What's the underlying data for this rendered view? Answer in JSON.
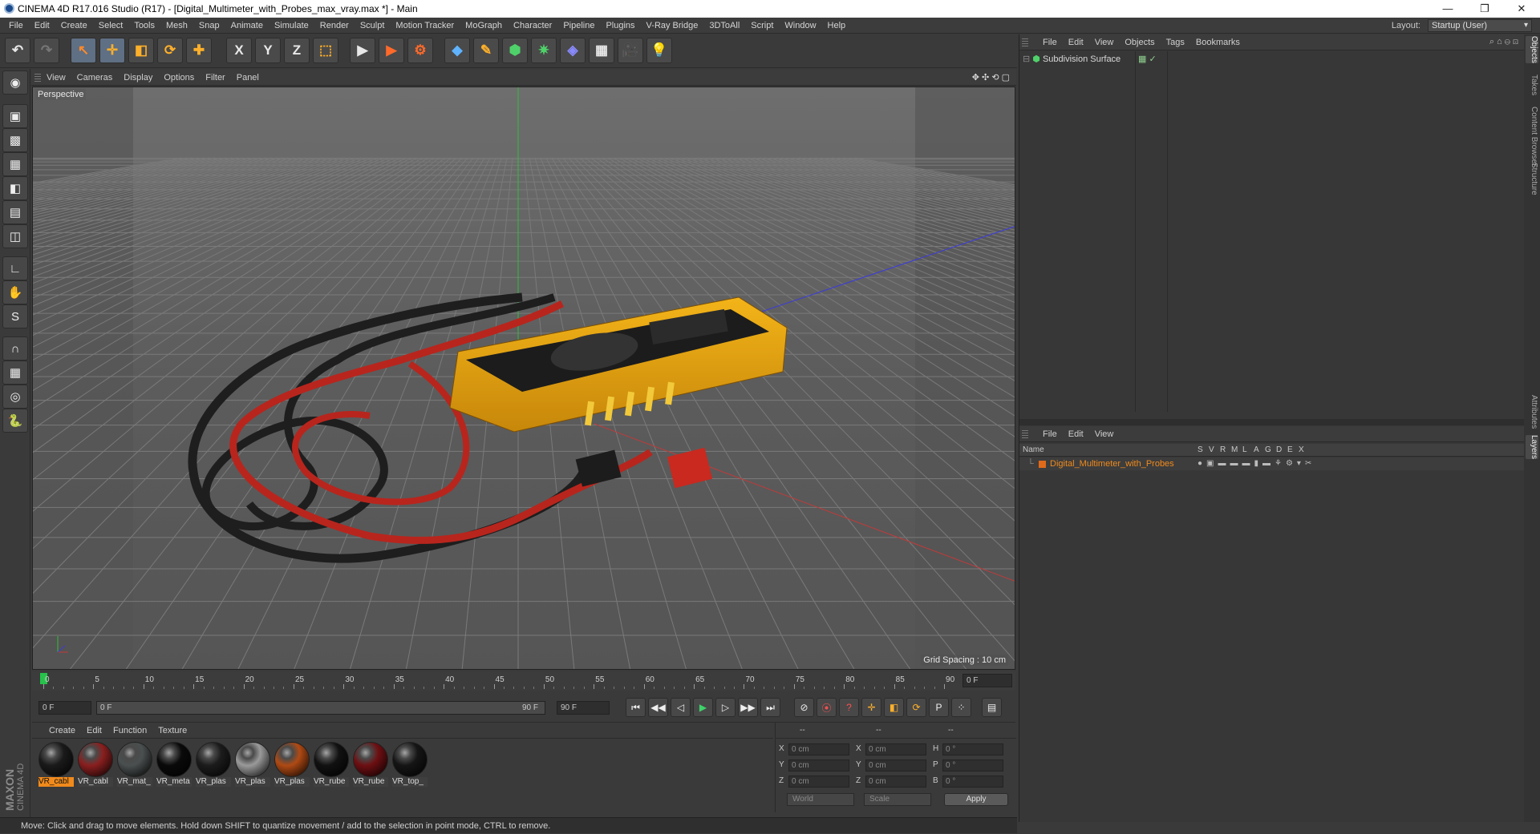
{
  "window": {
    "title": "CINEMA 4D R17.016 Studio (R17) - [Digital_Multimeter_with_Probes_max_vray.max *] - Main",
    "minimize": "—",
    "restore": "❐",
    "close": "✕"
  },
  "menubar": {
    "items": [
      "File",
      "Edit",
      "Create",
      "Select",
      "Tools",
      "Mesh",
      "Snap",
      "Animate",
      "Simulate",
      "Render",
      "Sculpt",
      "Motion Tracker",
      "MoGraph",
      "Character",
      "Pipeline",
      "Plugins",
      "V-Ray Bridge",
      "3DToAll",
      "Script",
      "Window",
      "Help"
    ],
    "layout_label": "Layout:",
    "layout_value": "Startup (User)"
  },
  "toolbar": {
    "undo": "↶",
    "redo": "↷",
    "select": "↖",
    "move": "✛",
    "scale": "◧",
    "rotate": "⟳",
    "create": "✚",
    "x_axis": "X",
    "y_axis": "Y",
    "z_axis": "Z",
    "coord_system": "⬚",
    "render_view": "▶",
    "render_picture": "▶",
    "render_settings": "⚙",
    "cube": "◆",
    "pen": "✎",
    "subdivision": "⬢",
    "array": "✷",
    "deformer": "◈",
    "floor": "▦",
    "camera": "🎥",
    "light": "💡"
  },
  "left_toolbar": [
    "◉",
    "▣",
    "▩",
    "▦",
    "◧",
    "▤",
    "◫",
    "∟",
    "✋",
    "S",
    "∩",
    "▦",
    "◎",
    "🐍"
  ],
  "viewport": {
    "menu": [
      "View",
      "Cameras",
      "Display",
      "Options",
      "Filter",
      "Panel"
    ],
    "label": "Perspective",
    "grid_spacing": "Grid Spacing : 10 cm",
    "nav_icons": "✥ ✣ ⟲ ▢"
  },
  "timeline": {
    "ticks": [
      "0",
      "5",
      "10",
      "15",
      "20",
      "25",
      "30",
      "35",
      "40",
      "45",
      "50",
      "55",
      "60",
      "65",
      "70",
      "75",
      "80",
      "85",
      "90"
    ],
    "current_frame_end": "0 F"
  },
  "playback": {
    "start_field": "0 F",
    "range_start": "0 F",
    "range_end": "90 F",
    "end_field": "90 F",
    "buttons": [
      "⏮",
      "◀◀",
      "◁",
      "▶",
      "▷",
      "▶▶",
      "⏭"
    ],
    "key_buttons": [
      "⊘",
      "⦿",
      "?",
      "✛",
      "◧",
      "⟳",
      "P",
      "⁘",
      "▤"
    ]
  },
  "materials": {
    "menu": [
      "Create",
      "Edit",
      "Function",
      "Texture"
    ],
    "items": [
      {
        "label": "VR_cabl",
        "color": "#1a1a1a",
        "selected": true
      },
      {
        "label": "VR_cabl",
        "color": "#8a1f1f",
        "selected": false
      },
      {
        "label": "VR_mat_",
        "color": "#4a4f4f",
        "selected": false
      },
      {
        "label": "VR_meta",
        "color": "#0a0a0a",
        "selected": false
      },
      {
        "label": "VR_plas",
        "color": "#1c1c1c",
        "selected": false
      },
      {
        "label": "VR_plas",
        "color": "#9a9a9a",
        "selected": false
      },
      {
        "label": "VR_plas",
        "color": "#b04a14",
        "selected": false
      },
      {
        "label": "VR_rube",
        "color": "#111111",
        "selected": false
      },
      {
        "label": "VR_rube",
        "color": "#6e0f12",
        "selected": false
      },
      {
        "label": "VR_top_",
        "color": "#151515",
        "selected": false
      }
    ]
  },
  "coordinates": {
    "headers": [
      "--",
      "--",
      "--"
    ],
    "rows": [
      {
        "a": "X",
        "av": "0 cm",
        "b": "X",
        "bv": "0 cm",
        "c": "H",
        "cv": "0 °"
      },
      {
        "a": "Y",
        "av": "0 cm",
        "b": "Y",
        "bv": "0 cm",
        "c": "P",
        "cv": "0 °"
      },
      {
        "a": "Z",
        "av": "0 cm",
        "b": "Z",
        "bv": "0 cm",
        "c": "B",
        "cv": "0 °"
      }
    ],
    "world": "World",
    "scale": "Scale",
    "apply": "Apply"
  },
  "statusbar": "Move: Click and drag to move elements. Hold down SHIFT to quantize movement / add to the selection in point mode, CTRL to remove.",
  "maxon": {
    "brand": "MAXON",
    "product": "CINEMA 4D"
  },
  "objects_panel": {
    "menu": [
      "File",
      "Edit",
      "View",
      "Objects",
      "Tags",
      "Bookmarks"
    ],
    "items": [
      {
        "name": "Subdivision Surface"
      }
    ]
  },
  "layers_panel": {
    "menu": [
      "File",
      "Edit",
      "View"
    ],
    "columns": [
      "Name",
      "S",
      "V",
      "R",
      "M",
      "L",
      "A",
      "G",
      "D",
      "E",
      "X"
    ],
    "items": [
      {
        "name": "Digital_Multimeter_with_Probes",
        "color": "#e06a1a"
      }
    ]
  },
  "side_tabs": [
    "Objects",
    "Takes",
    "Content Browser",
    "Structure",
    "Attributes",
    "Layers"
  ]
}
